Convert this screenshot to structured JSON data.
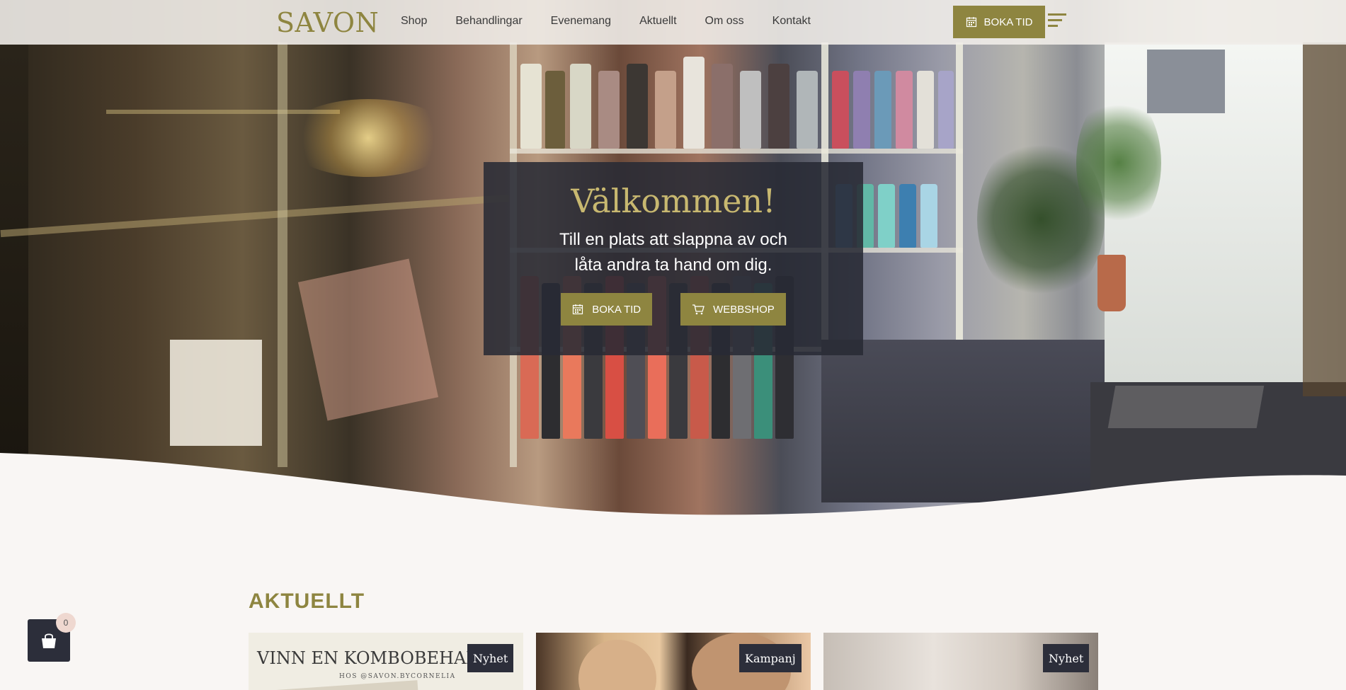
{
  "header": {
    "logo": "SAVON",
    "nav": [
      "Shop",
      "Behandlingar",
      "Evenemang",
      "Aktuellt",
      "Om oss",
      "Kontakt"
    ],
    "book_label": "BOKA TID",
    "menu_icon": "hamburger-icon"
  },
  "hero": {
    "title": "Välkommen!",
    "subtitle_line1": "Till en plats att slappna av och",
    "subtitle_line2": "låta andra ta hand om dig.",
    "book_label": "BOKA TID",
    "shop_label": "WEBBSHOP",
    "book_icon": "calendar-icon",
    "shop_icon": "cart-icon"
  },
  "news": {
    "title": "AKTUELLT",
    "cards": [
      {
        "headline": "VINN EN KOMBOBEHAND",
        "sub": "HOS @SAVON.BYCORNELIA",
        "badge": "Nyhet"
      },
      {
        "badge": "Kampanj"
      },
      {
        "badge": "Nyhet"
      }
    ]
  },
  "cart": {
    "count": "0",
    "icon": "shopping-bag-icon"
  },
  "colors": {
    "accent": "#8e8540",
    "dark": "#2c2e3a",
    "background": "#f9f6f4"
  }
}
